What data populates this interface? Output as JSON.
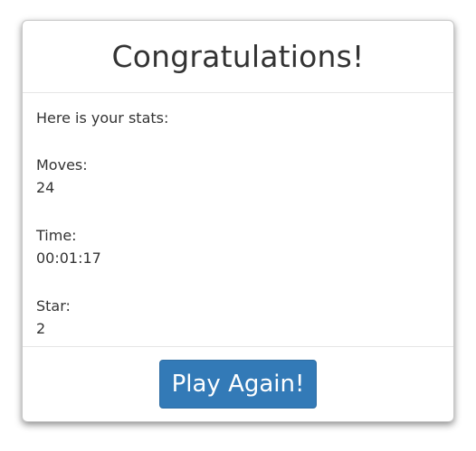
{
  "modal": {
    "title": "Congratulations!",
    "intro": "Here is your stats:",
    "stats": [
      {
        "label": "Moves:",
        "value": "24"
      },
      {
        "label": "Time:",
        "value": "00:01:17"
      },
      {
        "label": "Star:",
        "value": "2"
      }
    ],
    "play_again_label": "Play Again!"
  },
  "colors": {
    "button_bg": "#337ab7",
    "text": "#333333"
  }
}
